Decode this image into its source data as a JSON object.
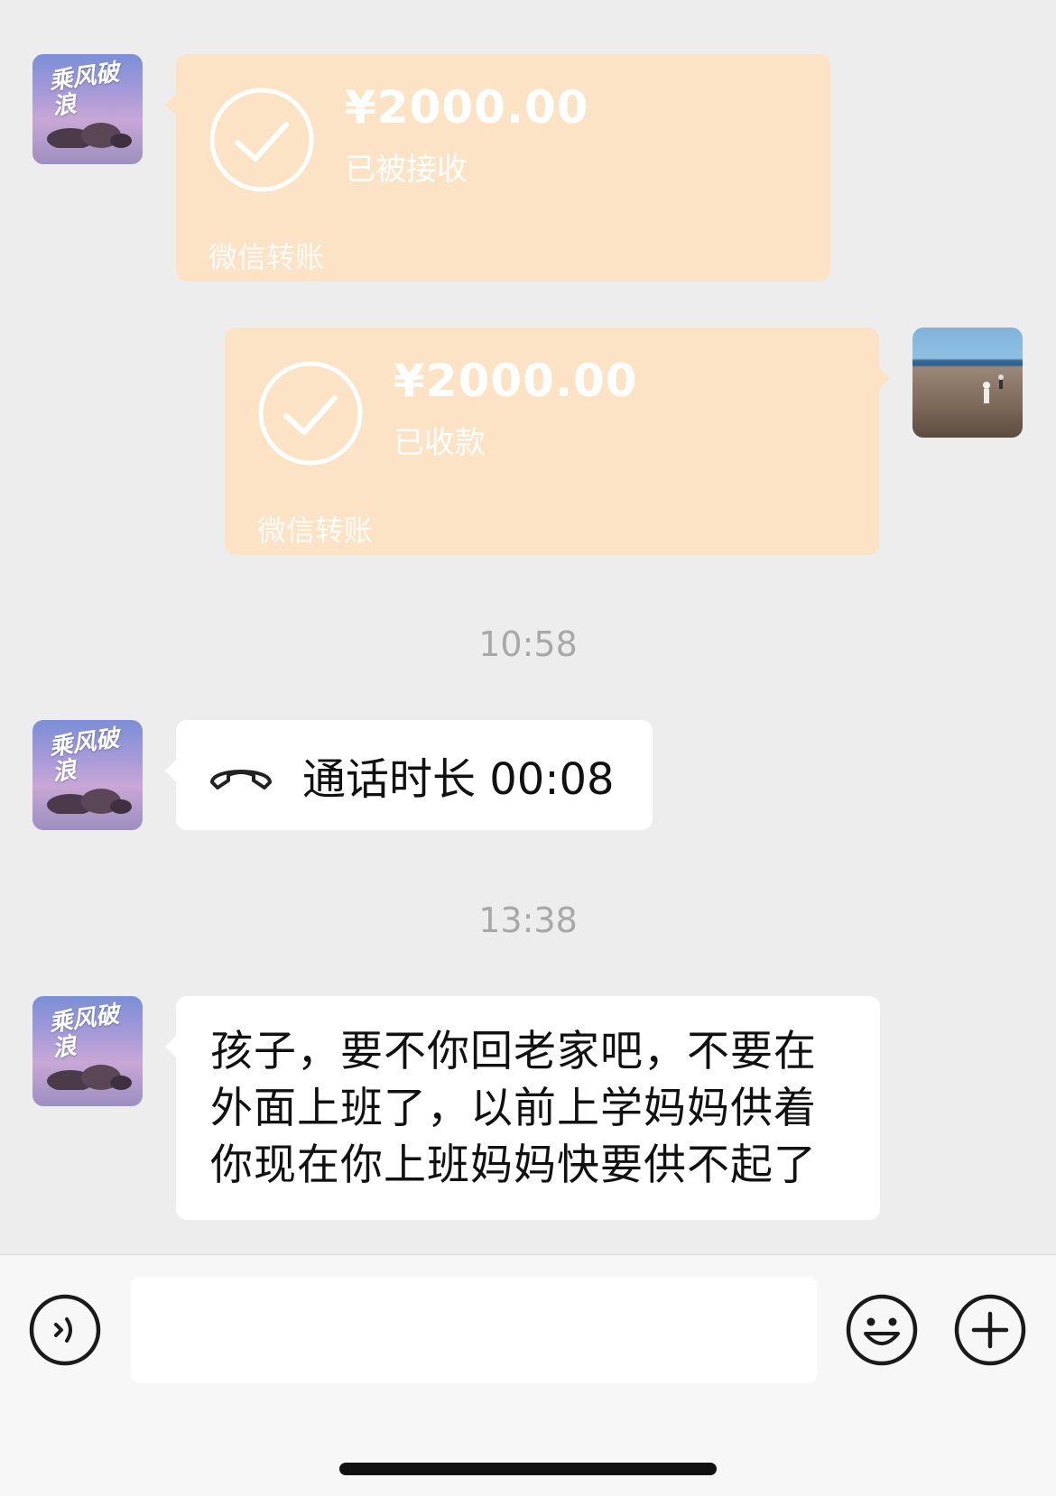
{
  "messages": [
    {
      "type": "transfer",
      "side": "left",
      "amount": "¥2000.00",
      "status": "已被接收",
      "footer": "微信转账"
    },
    {
      "type": "transfer",
      "side": "right",
      "amount": "¥2000.00",
      "status": "已收款",
      "footer": "微信转账"
    },
    {
      "type": "time",
      "text": "10:58"
    },
    {
      "type": "call",
      "side": "left",
      "text": "通话时长 00:08"
    },
    {
      "type": "time",
      "text": "13:38"
    },
    {
      "type": "text",
      "side": "left",
      "lines": [
        "孩子，要不你回老家吧，不要在",
        "外面上班了，以前上学妈妈供着",
        "你现在你上班妈妈快要供不起了"
      ]
    }
  ],
  "avatar_mom": {
    "logo_text": "乘风破浪"
  },
  "input_bar": {
    "voice_icon": "voice-icon",
    "emoji_icon": "emoji-icon",
    "plus_icon": "plus-icon",
    "placeholder": ""
  },
  "colors": {
    "background": "#ededed",
    "transfer_bubble": "#fce3c5",
    "bubble": "#ffffff",
    "time": "#a8a8a8"
  }
}
